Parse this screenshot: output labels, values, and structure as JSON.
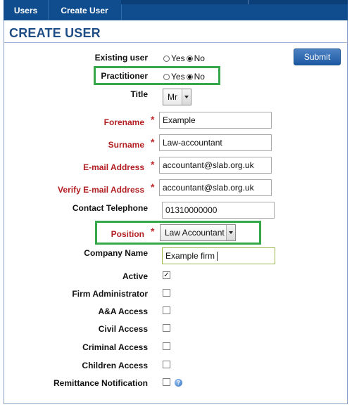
{
  "tabs": [
    {
      "label": "Users"
    },
    {
      "label": "Create User"
    }
  ],
  "page_title": "CREATE USER",
  "submit_label": "Submit",
  "fields": {
    "existing_user": {
      "label": "Existing user",
      "yes": "Yes",
      "no": "No",
      "selected": "No"
    },
    "practitioner": {
      "label": "Practitioner",
      "yes": "Yes",
      "no": "No",
      "selected": "No"
    },
    "title": {
      "label": "Title",
      "value": "Mr"
    },
    "forename": {
      "label": "Forename",
      "value": "Example"
    },
    "surname": {
      "label": "Surname",
      "value": "Law-accountant"
    },
    "email": {
      "label": "E-mail Address",
      "value": "accountant@slab.org.uk"
    },
    "verify_email": {
      "label": "Verify E-mail Address",
      "value": "accountant@slab.org.uk"
    },
    "contact_telephone": {
      "label": "Contact Telephone",
      "value": "01310000000"
    },
    "position": {
      "label": "Position",
      "value": "Law Accountant"
    },
    "company_name": {
      "label": "Company Name",
      "value": "Example firm"
    }
  },
  "required_marker": "*",
  "checkboxes": [
    {
      "label": "Active",
      "checked": true
    },
    {
      "label": "Firm Administrator",
      "checked": false
    },
    {
      "label": "A&A Access",
      "checked": false
    },
    {
      "label": "Civil Access",
      "checked": false
    },
    {
      "label": "Criminal Access",
      "checked": false
    },
    {
      "label": "Children Access",
      "checked": false
    },
    {
      "label": "Remittance Notification",
      "checked": false
    }
  ],
  "help_glyph": "?",
  "colors": {
    "tabbar": "#0f4d8f",
    "title": "#1f4e86",
    "required": "#b21f23",
    "highlight": "#36a84b",
    "submit": "#1d5aa3"
  }
}
